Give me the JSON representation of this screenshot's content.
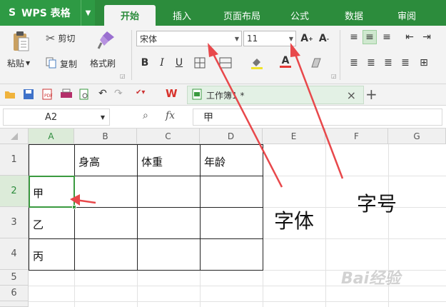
{
  "titlebar": {
    "app_logo": "S",
    "app_name": "WPS 表格",
    "tabs": [
      "开始",
      "插入",
      "页面布局",
      "公式",
      "数据",
      "审阅"
    ],
    "active_tab": "开始"
  },
  "ribbon": {
    "paste_label": "粘贴",
    "cut_label": "剪切",
    "copy_label": "复制",
    "format_painter_label": "格式刷",
    "font_name": "宋体",
    "font_size": "11",
    "bold": "B",
    "italic": "I",
    "underline": "U",
    "font_color_letter": "A"
  },
  "quick_access": {
    "doc_tab_label": "工作簿1 *",
    "close_glyph": "×",
    "add_glyph": "+"
  },
  "formula_bar": {
    "cell_ref": "A2",
    "fx_label": "fx",
    "value": "甲"
  },
  "grid": {
    "columns": [
      "A",
      "B",
      "C",
      "D",
      "E",
      "F",
      "G"
    ],
    "rows": [
      "1",
      "2",
      "3",
      "4",
      "5",
      "6"
    ],
    "headers": [
      "身高",
      "体重",
      "年龄"
    ],
    "names": [
      "甲",
      "乙",
      "丙"
    ],
    "selected_cell": "A2"
  },
  "annotations": {
    "font_label": "字体",
    "size_label": "字号",
    "arrow_color": "#e8484b"
  },
  "watermark": "Bai经验",
  "colors": {
    "brand_green": "#2c8c3c",
    "selection_green": "#3a9a3f"
  }
}
